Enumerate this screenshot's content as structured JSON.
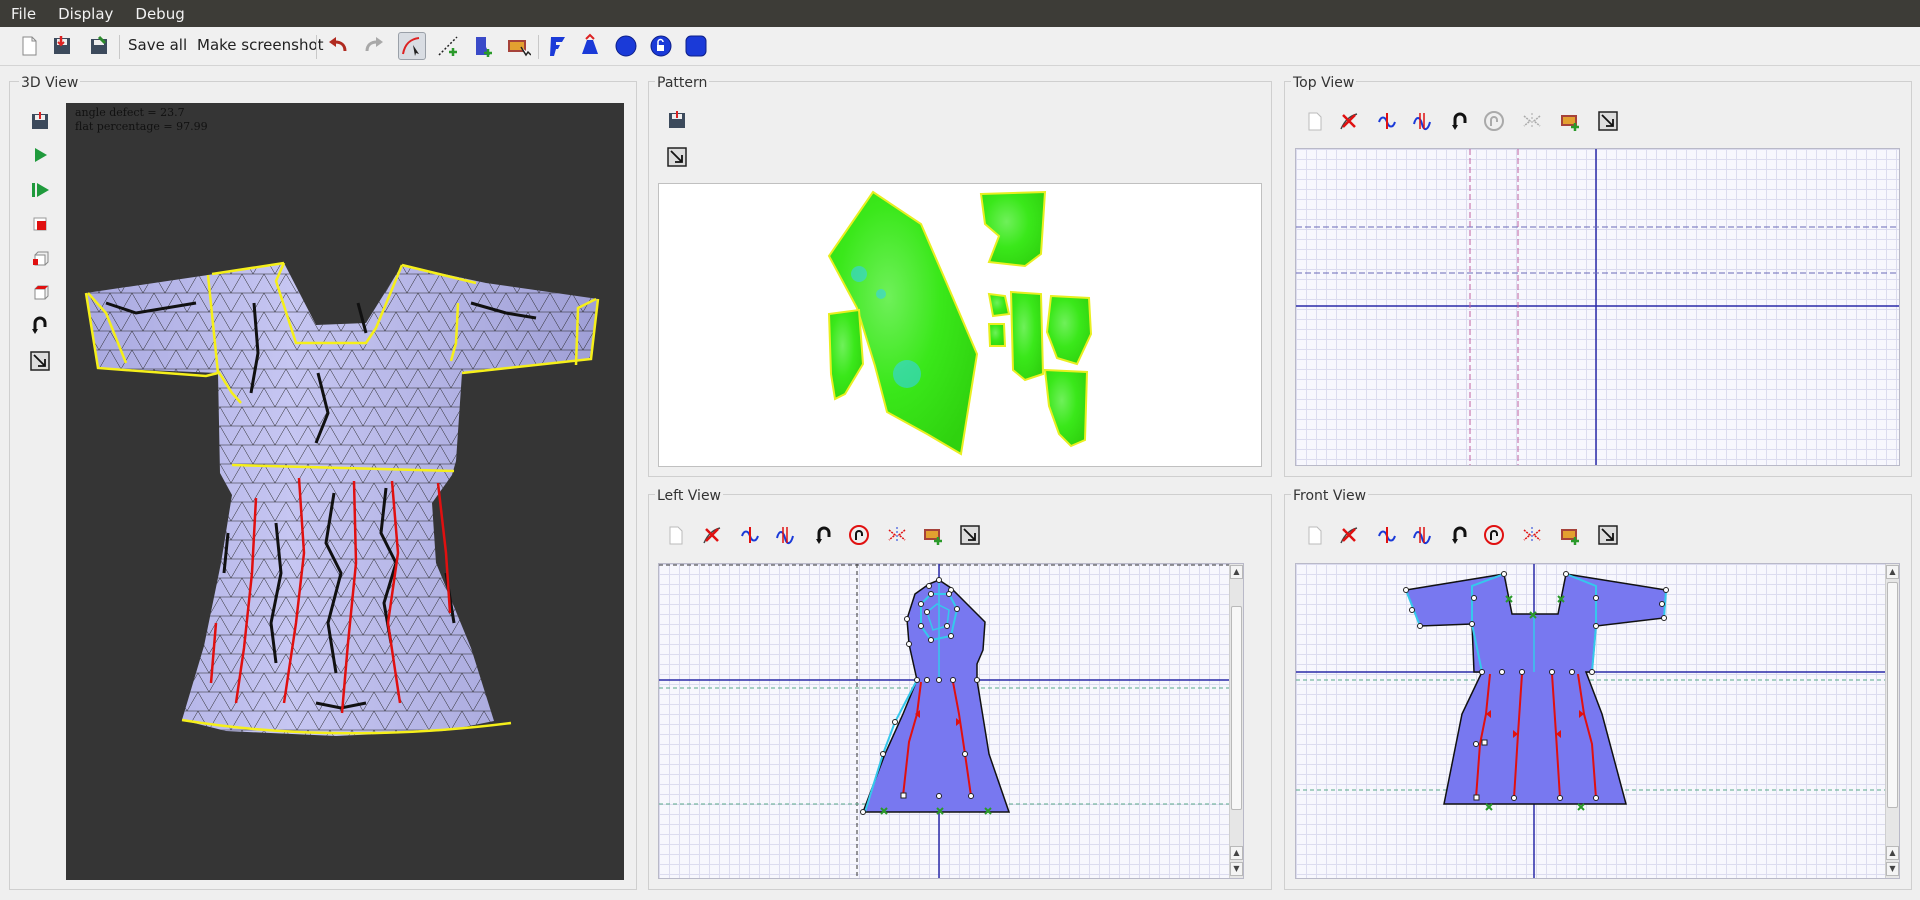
{
  "menu": {
    "file": "File",
    "display": "Display",
    "debug": "Debug"
  },
  "toolbar": {
    "save_all": "Save all",
    "make_screenshot": "Make screenshot",
    "icons": [
      "new-document-icon",
      "save-icon",
      "save-as-icon",
      "undo-icon",
      "redo-icon",
      "curve-edit-icon",
      "add-point-icon",
      "add-mesh-icon",
      "import-image-icon",
      "pattern-shape-icon",
      "pin-shape-icon",
      "circle-icon",
      "circle-lock-icon",
      "rounded-square-icon"
    ]
  },
  "view3d": {
    "title": "3D View",
    "stats_line1": "angle defect = 23.7",
    "stats_line2": "flat percentage = 97.99",
    "tools": [
      "save-icon",
      "play-icon",
      "step-play-icon",
      "red-square-icon",
      "cube-icon",
      "cube-top-icon",
      "arc-arrow-icon",
      "resize-icon"
    ]
  },
  "pattern": {
    "title": "Pattern"
  },
  "top_view": {
    "title": "Top View"
  },
  "left_view": {
    "title": "Left View"
  },
  "front_view": {
    "title": "Front View"
  },
  "colors": {
    "mesh_fill": "#b9b9ee",
    "seam_yellow": "#f5ef1a",
    "seam_red": "#e01010",
    "pattern_green": "#37e81a",
    "sketch_fill": "#7878f0",
    "axis_blue": "#2a2aa8",
    "canvas_dark": "#353535"
  }
}
